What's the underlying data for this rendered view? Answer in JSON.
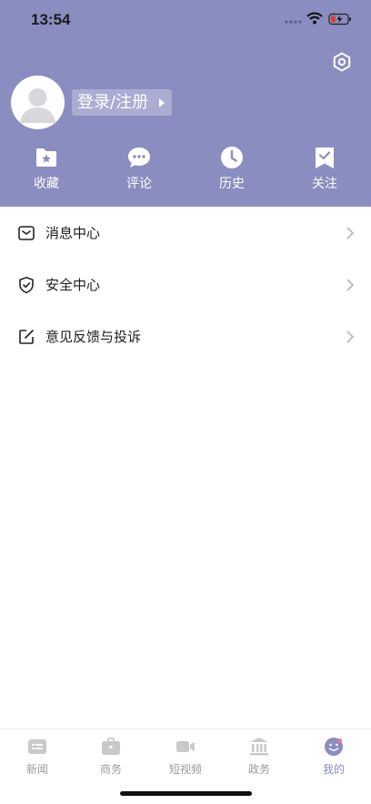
{
  "status_bar": {
    "time": "13:54"
  },
  "profile": {
    "login_label": "登录/注册"
  },
  "quick_actions": [
    {
      "label": "收藏",
      "icon": "star-folder-icon"
    },
    {
      "label": "评论",
      "icon": "comment-bubble-icon"
    },
    {
      "label": "历史",
      "icon": "clock-icon"
    },
    {
      "label": "关注",
      "icon": "bookmark-check-icon"
    }
  ],
  "menu": [
    {
      "label": "消息中心",
      "icon": "message-icon"
    },
    {
      "label": "安全中心",
      "icon": "shield-check-icon"
    },
    {
      "label": "意见反馈与投诉",
      "icon": "edit-icon"
    }
  ],
  "tabbar": [
    {
      "label": "新闻",
      "icon": "news-icon",
      "active": false
    },
    {
      "label": "商务",
      "icon": "briefcase-icon",
      "active": false
    },
    {
      "label": "短视频",
      "icon": "video-camera-icon",
      "active": false
    },
    {
      "label": "政务",
      "icon": "government-building-icon",
      "active": false
    },
    {
      "label": "我的",
      "icon": "smile-profile-icon",
      "active": true
    }
  ],
  "colors": {
    "header_bg": "#8a8dbf",
    "tab_inactive": "#9a9a9a",
    "tab_active": "#8a8dbf"
  }
}
